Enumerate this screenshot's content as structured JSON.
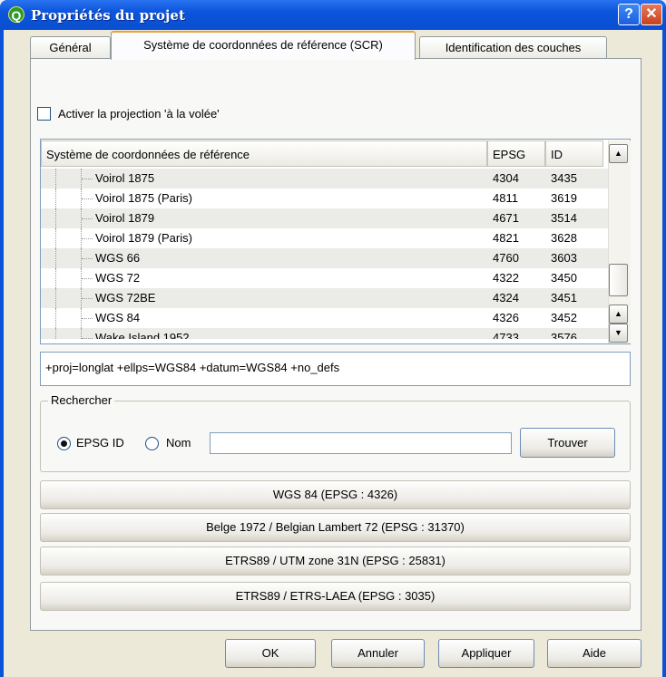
{
  "window": {
    "title": "Propriétés du projet",
    "help_label": "?",
    "close_label": "✕",
    "app_icon_letter": "Q"
  },
  "tabs": [
    {
      "label": "Général",
      "active": false
    },
    {
      "label": "Système de coordonnées de référence (SCR)",
      "active": true
    },
    {
      "label": "Identification des couches",
      "active": false
    }
  ],
  "checkbox": {
    "label": "Activer la projection 'à la volée'",
    "checked": false
  },
  "crs_table": {
    "headers": [
      "Système de coordonnées de référence",
      "EPSG",
      "ID"
    ],
    "rows": [
      {
        "name": "Voirol 1875",
        "epsg": "4304",
        "id": "3435"
      },
      {
        "name": "Voirol 1875 (Paris)",
        "epsg": "4811",
        "id": "3619"
      },
      {
        "name": "Voirol 1879",
        "epsg": "4671",
        "id": "3514"
      },
      {
        "name": "Voirol 1879 (Paris)",
        "epsg": "4821",
        "id": "3628"
      },
      {
        "name": "WGS 66",
        "epsg": "4760",
        "id": "3603"
      },
      {
        "name": "WGS 72",
        "epsg": "4322",
        "id": "3450"
      },
      {
        "name": "WGS 72BE",
        "epsg": "4324",
        "id": "3451"
      },
      {
        "name": "WGS 84",
        "epsg": "4326",
        "id": "3452"
      },
      {
        "name": "Wake Island 1952",
        "epsg": "4733",
        "id": "3576"
      }
    ]
  },
  "proj_string": "+proj=longlat +ellps=WGS84 +datum=WGS84 +no_defs",
  "search": {
    "group_title": "Rechercher",
    "radio_epsg": "EPSG ID",
    "radio_name": "Nom",
    "selected": "EPSG ID",
    "input_value": "",
    "find_button": "Trouver"
  },
  "recent_crs": [
    "WGS 84 (EPSG : 4326)",
    "Belge 1972 / Belgian Lambert 72 (EPSG : 31370)",
    "ETRS89 / UTM zone 31N (EPSG : 25831)",
    "ETRS89 / ETRS-LAEA (EPSG : 3035)"
  ],
  "buttons": {
    "ok": "OK",
    "cancel": "Annuler",
    "apply": "Appliquer",
    "help": "Aide"
  },
  "icons": {
    "scroll_up": "▲",
    "scroll_down": "▼"
  }
}
